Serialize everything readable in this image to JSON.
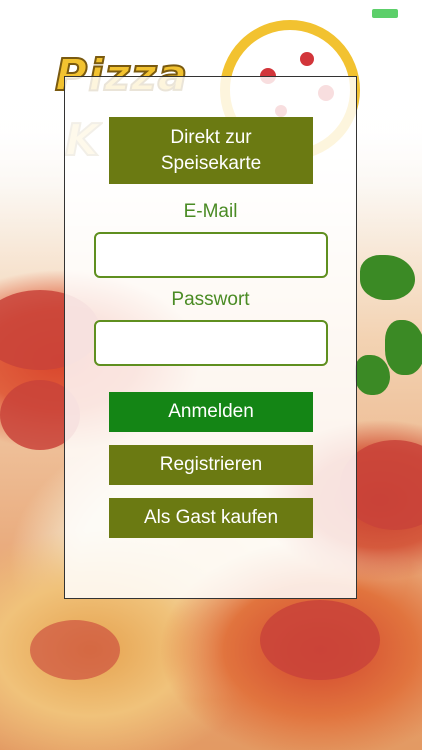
{
  "brand": {
    "logo_word1": "Pizza",
    "logo_word2": "K"
  },
  "panel": {
    "menu_button_line1": "Direkt zur",
    "menu_button_line2": "Speisekarte",
    "email_label": "E-Mail",
    "email_value": "",
    "password_label": "Passwort",
    "password_value": "",
    "login_button": "Anmelden",
    "register_button": "Registrieren",
    "guest_button": "Als Gast kaufen"
  },
  "colors": {
    "olive": "#6b7a12",
    "green": "#148515",
    "label_green": "#4a8b24"
  }
}
